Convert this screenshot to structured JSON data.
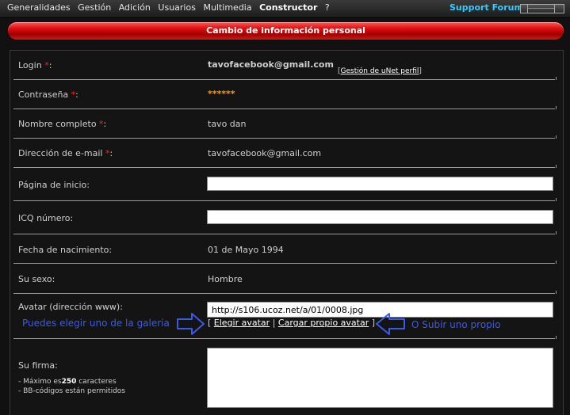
{
  "menu": {
    "items": [
      "Generalidades",
      "Gestión",
      "Adición",
      "Usuarios",
      "Multimedia",
      "Constructor",
      "?"
    ],
    "support": "Support Forum"
  },
  "title": "Cambio de información personal",
  "required_mark": "*",
  "form": {
    "login": {
      "label": "Login",
      "value": "tavofacebook@gmail.com",
      "link": "Gestión de uNet perfil"
    },
    "password": {
      "label": "Contraseña",
      "value": "******"
    },
    "fullname": {
      "label": "Nombre completo",
      "value": "tavo dan"
    },
    "email": {
      "label": "Dirección de e-mail",
      "value": "tavofacebook@gmail.com"
    },
    "homepage": {
      "label": "Página de inicio:",
      "value": ""
    },
    "icq": {
      "label": "ICQ número:",
      "value": ""
    },
    "birthdate": {
      "label": "Fecha de nacimiento:",
      "value": "01 de Mayo 1994"
    },
    "gender": {
      "label": "Su sexo:",
      "value": "Hombre"
    },
    "avatar": {
      "label": "Avatar (dirección www):",
      "value": "http://s106.ucoz.net/a/01/0008.jpg",
      "choose": "Elegir avatar",
      "upload": "Cargar propio avatar"
    },
    "signature": {
      "label": "Su firma:",
      "note1_prefix": "- Máximo es",
      "note1_number": "250",
      "note1_suffix": " caracteres",
      "note2": "- BB-códigos están permitidos"
    }
  },
  "annotations": {
    "left": "Puedes elegir uno de la galeria",
    "right": "O Subir uno propio"
  },
  "colors": {
    "accent_red": "#e01010",
    "annotation_blue": "#3c5ae8",
    "support_blue": "#33ccff"
  }
}
